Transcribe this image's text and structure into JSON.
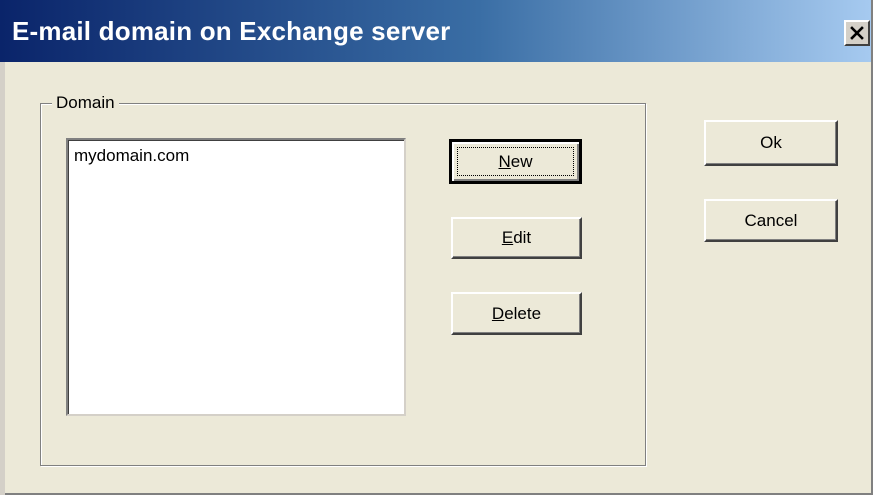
{
  "window": {
    "title": "E-mail domain on Exchange server",
    "close_icon": "close-icon"
  },
  "domain_group": {
    "label": "Domain",
    "items": [
      "mydomain.com"
    ]
  },
  "buttons": {
    "new": {
      "mnemonic": "N",
      "rest": "ew"
    },
    "edit": {
      "mnemonic": "E",
      "rest": "dit"
    },
    "delete": {
      "mnemonic": "D",
      "rest": "elete"
    },
    "ok": "Ok",
    "cancel": "Cancel"
  }
}
